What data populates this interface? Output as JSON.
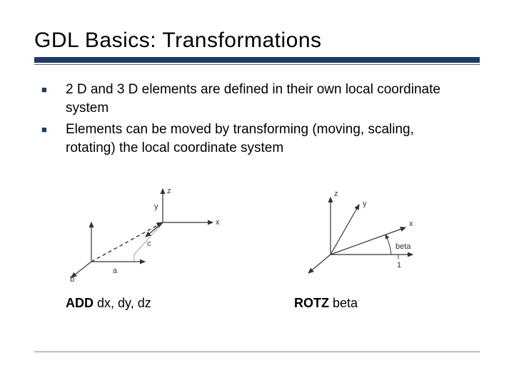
{
  "title": "GDL Basics: Transformations",
  "bullets": [
    "2 D and 3 D elements are defined in their own local coordinate system",
    "Elements can be moved by transforming (moving, scaling, rotating) the local coordinate system"
  ],
  "diagram1": {
    "labels": {
      "z": "z",
      "y": "y",
      "x": "x",
      "a": "a",
      "b": "b",
      "c": "c"
    },
    "caption_cmd": "ADD",
    "caption_args": " dx, dy, dz"
  },
  "diagram2": {
    "labels": {
      "z": "z",
      "y": "y",
      "x": "x",
      "beta": "beta",
      "one": "1"
    },
    "caption_cmd": "ROTZ",
    "caption_args": " beta"
  }
}
